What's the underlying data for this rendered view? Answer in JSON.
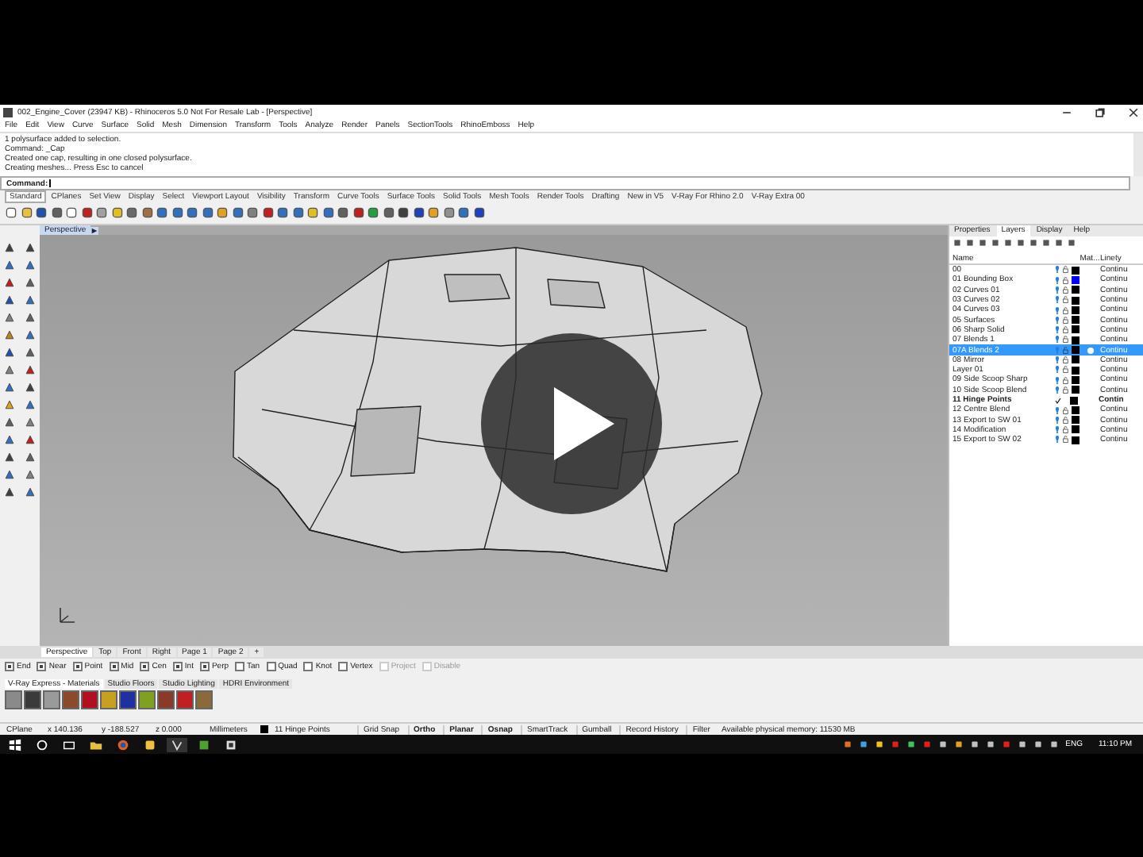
{
  "window": {
    "title": "002_Engine_Cover (23947 KB) - Rhinoceros 5.0 Not For Resale Lab - [Perspective]"
  },
  "menu": [
    "File",
    "Edit",
    "View",
    "Curve",
    "Surface",
    "Solid",
    "Mesh",
    "Dimension",
    "Transform",
    "Tools",
    "Analyze",
    "Render",
    "Panels",
    "SectionTools",
    "RhinoEmboss",
    "Help"
  ],
  "command_history": [
    "1 polysurface added to selection.",
    "Command: _Cap",
    "Created one cap, resulting in one closed polysurface.",
    "Creating meshes... Press Esc to cancel"
  ],
  "command_prompt": "Command:",
  "toolbar_tabs": [
    {
      "label": "Standard",
      "selected": true
    },
    {
      "label": "CPlanes",
      "selected": false
    },
    {
      "label": "Set View",
      "selected": false
    },
    {
      "label": "Display",
      "selected": false
    },
    {
      "label": "Select",
      "selected": false
    },
    {
      "label": "Viewport Layout",
      "selected": false
    },
    {
      "label": "Visibility",
      "selected": false
    },
    {
      "label": "Transform",
      "selected": false
    },
    {
      "label": "Curve Tools",
      "selected": false
    },
    {
      "label": "Surface Tools",
      "selected": false
    },
    {
      "label": "Solid Tools",
      "selected": false
    },
    {
      "label": "Mesh Tools",
      "selected": false
    },
    {
      "label": "Render Tools",
      "selected": false
    },
    {
      "label": "Drafting",
      "selected": false
    },
    {
      "label": "New in V5",
      "selected": false
    },
    {
      "label": "V-Ray For Rhino 2.0",
      "selected": false
    },
    {
      "label": "V-Ray Extra 00",
      "selected": false
    }
  ],
  "viewport_title": "Perspective",
  "panel_tabs": [
    {
      "label": "Properties",
      "selected": false
    },
    {
      "label": "Layers",
      "selected": true
    },
    {
      "label": "Display",
      "selected": false
    },
    {
      "label": "Help",
      "selected": false
    }
  ],
  "layer_columns": [
    "Name",
    "Mat...",
    "Linety"
  ],
  "layers": [
    {
      "name": "00",
      "current": false,
      "selected": false,
      "color": "#000000",
      "linetype": "Continu"
    },
    {
      "name": "01 Bounding Box",
      "current": false,
      "selected": false,
      "color": "#0000ff",
      "linetype": "Continu"
    },
    {
      "name": "02 Curves 01",
      "current": false,
      "selected": false,
      "color": "#000000",
      "linetype": "Continu"
    },
    {
      "name": "03 Curves 02",
      "current": false,
      "selected": false,
      "color": "#000000",
      "linetype": "Continu"
    },
    {
      "name": "04 Curves 03",
      "current": false,
      "selected": false,
      "color": "#000000",
      "linetype": "Continu"
    },
    {
      "name": "05 Surfaces",
      "current": false,
      "selected": false,
      "color": "#000000",
      "linetype": "Continu"
    },
    {
      "name": "06 Sharp Solid",
      "current": false,
      "selected": false,
      "color": "#000000",
      "linetype": "Continu"
    },
    {
      "name": "07 Blends 1",
      "current": false,
      "selected": false,
      "color": "#000000",
      "linetype": "Continu"
    },
    {
      "name": "07A Blends 2",
      "current": false,
      "selected": true,
      "color": "#000000",
      "linetype": "Continu"
    },
    {
      "name": "08 Mirror",
      "current": false,
      "selected": false,
      "color": "#000000",
      "linetype": "Continu"
    },
    {
      "name": "Layer 01",
      "current": false,
      "selected": false,
      "color": "#000000",
      "linetype": "Continu"
    },
    {
      "name": "09 Side Scoop Sharp",
      "current": false,
      "selected": false,
      "color": "#000000",
      "linetype": "Continu"
    },
    {
      "name": "10 Side Scoop Blend",
      "current": false,
      "selected": false,
      "color": "#000000",
      "linetype": "Continu"
    },
    {
      "name": "11 Hinge Points",
      "current": true,
      "selected": false,
      "color": "#000000",
      "linetype": "Contin"
    },
    {
      "name": "12 Centre Blend",
      "current": false,
      "selected": false,
      "color": "#000000",
      "linetype": "Continu"
    },
    {
      "name": "13 Export to SW 01",
      "current": false,
      "selected": false,
      "color": "#000000",
      "linetype": "Continu"
    },
    {
      "name": "14 Modification",
      "current": false,
      "selected": false,
      "color": "#000000",
      "linetype": "Continu"
    },
    {
      "name": "15 Export to SW 02",
      "current": false,
      "selected": false,
      "color": "#000000",
      "linetype": "Continu"
    }
  ],
  "viewport_tabs": [
    {
      "label": "Perspective",
      "selected": true
    },
    {
      "label": "Top",
      "selected": false
    },
    {
      "label": "Front",
      "selected": false
    },
    {
      "label": "Right",
      "selected": false
    },
    {
      "label": "Page 1",
      "selected": false
    },
    {
      "label": "Page 2",
      "selected": false
    }
  ],
  "add_tab": "+",
  "osnaps": [
    {
      "label": "End",
      "checked": true,
      "disabled": false
    },
    {
      "label": "Near",
      "checked": true,
      "disabled": false
    },
    {
      "label": "Point",
      "checked": true,
      "disabled": false
    },
    {
      "label": "Mid",
      "checked": true,
      "disabled": false
    },
    {
      "label": "Cen",
      "checked": true,
      "disabled": false
    },
    {
      "label": "Int",
      "checked": true,
      "disabled": false
    },
    {
      "label": "Perp",
      "checked": true,
      "disabled": false
    },
    {
      "label": "Tan",
      "checked": false,
      "disabled": false
    },
    {
      "label": "Quad",
      "checked": false,
      "disabled": false
    },
    {
      "label": "Knot",
      "checked": false,
      "disabled": false
    },
    {
      "label": "Vertex",
      "checked": false,
      "disabled": false
    },
    {
      "label": "Project",
      "checked": false,
      "disabled": true
    },
    {
      "label": "Disable",
      "checked": false,
      "disabled": true
    }
  ],
  "material_tabs": [
    {
      "label": "V-Ray Express - Materials",
      "selected": true
    },
    {
      "label": "Studio Floors",
      "selected": false
    },
    {
      "label": "Studio Lighting",
      "selected": false
    },
    {
      "label": "HDRI Environment",
      "selected": false
    }
  ],
  "materials": [
    {
      "color": "#8a8a8a"
    },
    {
      "color": "#3a3a3a"
    },
    {
      "color": "#9a9a9a"
    },
    {
      "color": "#8b4a2a"
    },
    {
      "color": "#b01020"
    },
    {
      "color": "#c8a020"
    },
    {
      "color": "#2030a0"
    },
    {
      "color": "#80a020"
    },
    {
      "color": "#8a3a2a"
    },
    {
      "color": "#c02020"
    },
    {
      "color": "#8a6a3a"
    }
  ],
  "status": {
    "cplane": "CPlane",
    "x": "x 140.136",
    "y": "y -188.527",
    "z": "z 0.000",
    "units": "Millimeters",
    "layer": "11 Hinge Points"
  },
  "status_toggles": [
    {
      "label": "Grid Snap",
      "on": false
    },
    {
      "label": "Ortho",
      "on": true
    },
    {
      "label": "Planar",
      "on": true
    },
    {
      "label": "Osnap",
      "on": true
    },
    {
      "label": "SmartTrack",
      "on": false
    },
    {
      "label": "Gumball",
      "on": false
    },
    {
      "label": "Record History",
      "on": false
    },
    {
      "label": "Filter",
      "on": false
    }
  ],
  "memory": "Available physical memory: 11530 MB",
  "taskbar": {
    "language": "ENG",
    "time": "11:10 PM"
  }
}
